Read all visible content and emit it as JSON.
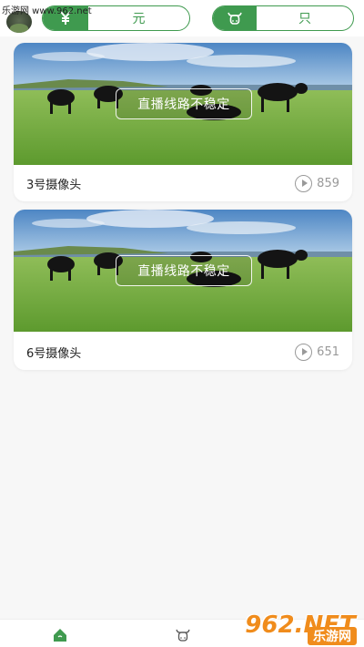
{
  "watermark": {
    "top_left": "乐游网 www.962.net",
    "logo": "962.NET",
    "sub": "乐游网"
  },
  "header": {
    "left_pill": {
      "icon": "yuan-sign-icon",
      "label": "元"
    },
    "right_pill": {
      "icon": "cow-icon",
      "label": "只"
    }
  },
  "cameras": [
    {
      "name": "3号摄像头",
      "views": "859",
      "status": "直播线路不稳定"
    },
    {
      "name": "6号摄像头",
      "views": "651",
      "status": "直播线路不稳定"
    }
  ],
  "bottom_nav": {
    "items": [
      "home-icon",
      "cow-icon"
    ]
  },
  "colors": {
    "accent": "#3f9a4f",
    "background": "#f7f7f7"
  }
}
